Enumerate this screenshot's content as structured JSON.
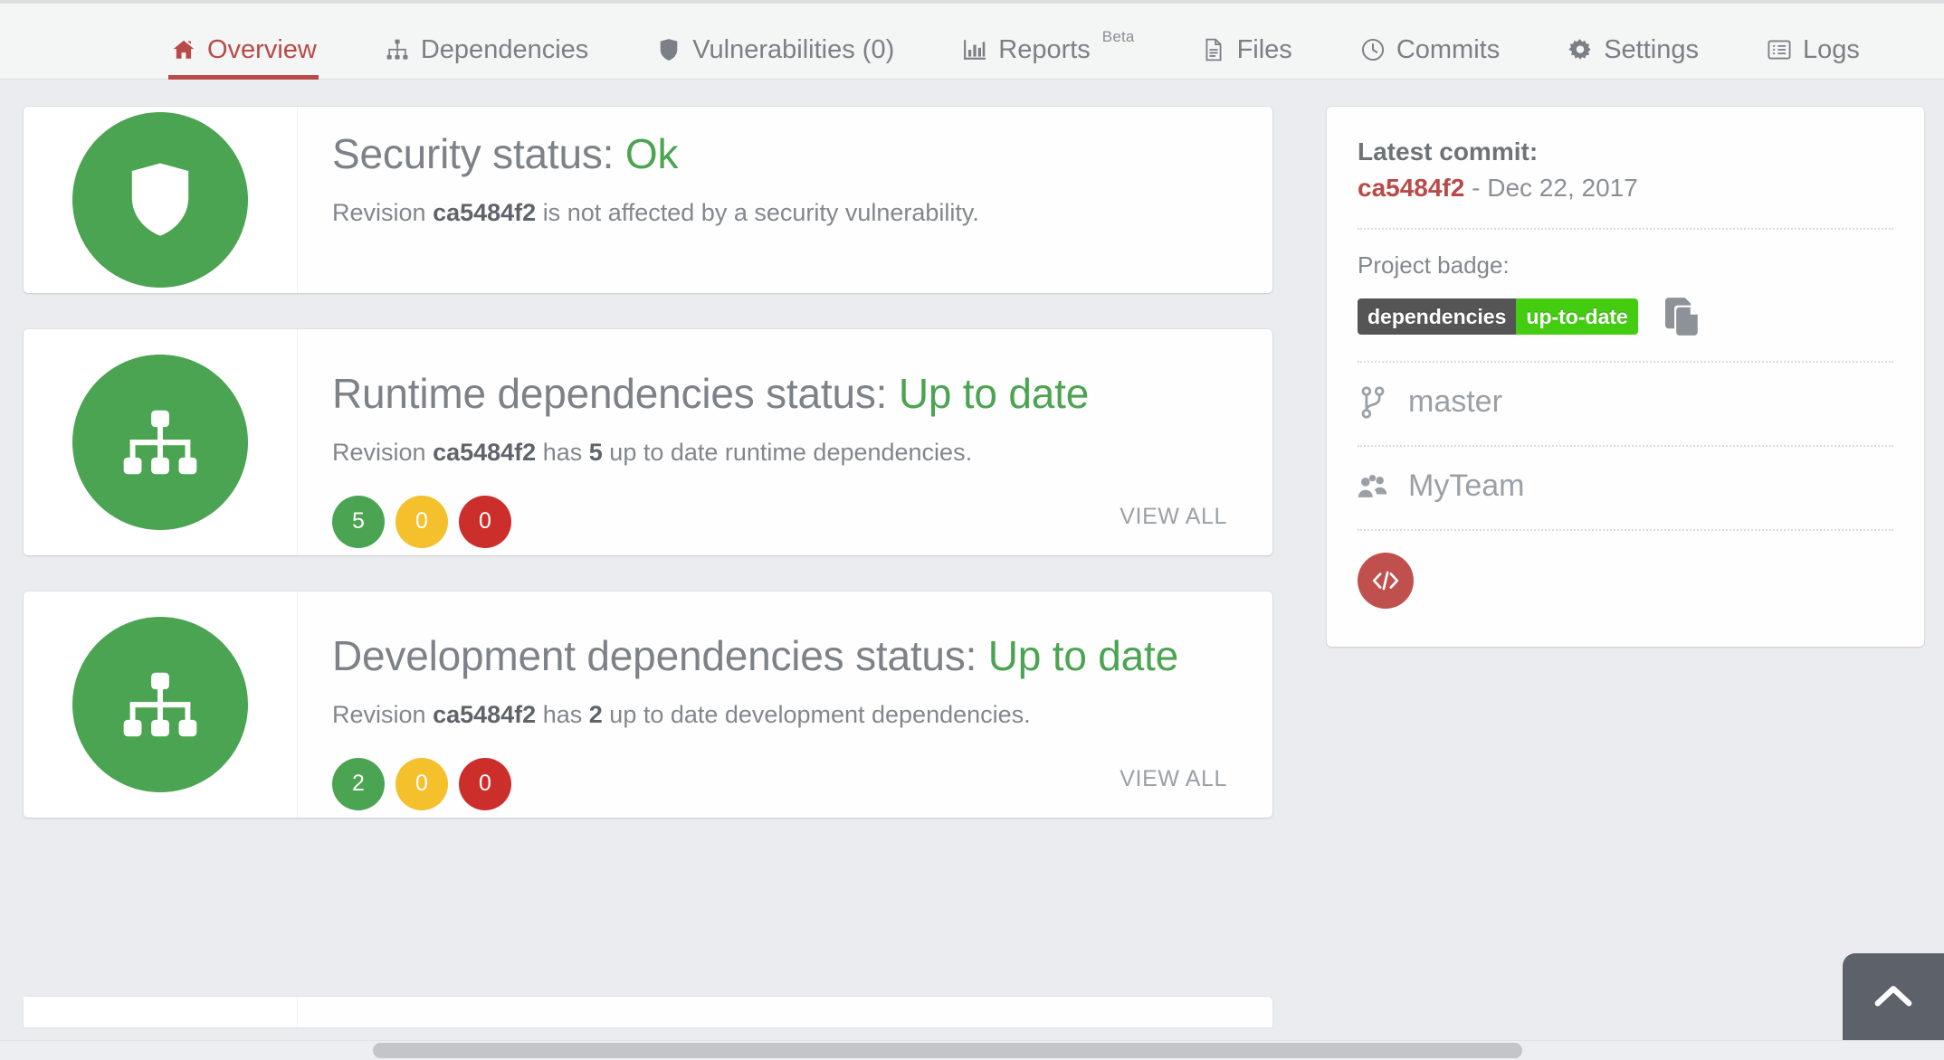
{
  "nav": {
    "tabs": [
      {
        "label": "Overview",
        "icon": "home-icon",
        "active": true,
        "beta": ""
      },
      {
        "label": "Dependencies",
        "icon": "sitemap-icon",
        "active": false,
        "beta": ""
      },
      {
        "label": "Vulnerabilities (0)",
        "icon": "shield-icon",
        "active": false,
        "beta": ""
      },
      {
        "label": "Reports",
        "icon": "bar-chart-icon",
        "active": false,
        "beta": "Beta"
      },
      {
        "label": "Files",
        "icon": "file-text-icon",
        "active": false,
        "beta": ""
      },
      {
        "label": "Commits",
        "icon": "clock-icon",
        "active": false,
        "beta": ""
      },
      {
        "label": "Settings",
        "icon": "gear-icon",
        "active": false,
        "beta": ""
      },
      {
        "label": "Logs",
        "icon": "list-alt-icon",
        "active": false,
        "beta": ""
      }
    ]
  },
  "cards": {
    "security": {
      "icon": "shield-icon",
      "title_prefix": "Security status:",
      "title_status": "Ok",
      "sub_a": "Revision",
      "sub_hash": "ca5484f2",
      "sub_b": "is not affected by a security vulnerability."
    },
    "runtime": {
      "icon": "sitemap-icon",
      "title_prefix": "Runtime dependencies status:",
      "title_status": "Up to date",
      "sub_a": "Revision",
      "sub_hash": "ca5484f2",
      "sub_mid": "has",
      "sub_count": "5",
      "sub_b": "up to date runtime dependencies.",
      "counters": {
        "green": "5",
        "yellow": "0",
        "red": "0"
      },
      "view_all": "VIEW ALL"
    },
    "development": {
      "icon": "sitemap-icon",
      "title_prefix": "Development dependencies status:",
      "title_status": "Up to date",
      "sub_a": "Revision",
      "sub_hash": "ca5484f2",
      "sub_mid": "has",
      "sub_count": "2",
      "sub_b": "up to date development dependencies.",
      "counters": {
        "green": "2",
        "yellow": "0",
        "red": "0"
      },
      "view_all": "VIEW ALL"
    }
  },
  "sidebar": {
    "latest_commit_label": "Latest commit:",
    "commit_hash": "ca5484f2",
    "commit_date_sep": " - ",
    "commit_date": "Dec 22, 2017",
    "project_badge_label": "Project badge:",
    "badge_left": "dependencies",
    "badge_right": "up-to-date",
    "copy_icon": "copy-icon",
    "branch_icon": "code-branch-icon",
    "branch": "master",
    "team_icon": "users-icon",
    "team": "MyTeam",
    "code_icon": "code-icon"
  },
  "chrome": {
    "scroll_top_icon": "chevron-up-icon",
    "hscrollbar": "horizontal-scrollbar"
  },
  "colors": {
    "accent_red": "#b94a48",
    "green": "#4ba451",
    "yellow": "#f4c02c",
    "red": "#cc2f2b",
    "badge_dark": "#555555",
    "badge_green": "#44cc11",
    "text_muted": "#82878d"
  }
}
